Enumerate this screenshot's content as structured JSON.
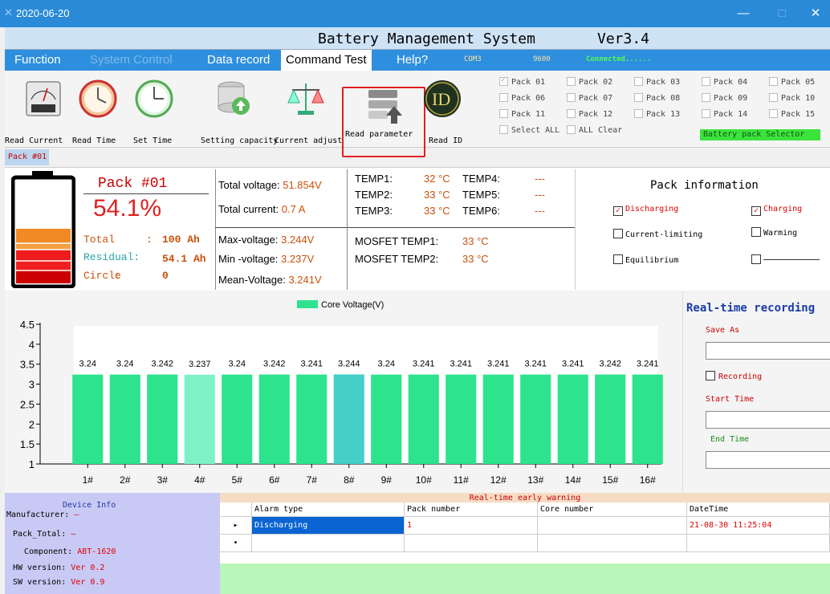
{
  "window": {
    "title": "2020-06-20"
  },
  "header": {
    "title": "Battery Management System",
    "version": "Ver3.4"
  },
  "menu": {
    "items": [
      "Function",
      "System Control",
      "Data record",
      "Command Test",
      "Help?"
    ],
    "com": "COM3",
    "baud": "9600",
    "status": "Connected......"
  },
  "toolbar": {
    "buttons": [
      "Read Current",
      "Read Time",
      "Set Time",
      "Setting capacity",
      "Current adjust",
      "Read parameter",
      "Read ID"
    ]
  },
  "packs": {
    "items": [
      "Pack 01",
      "Pack 02",
      "Pack 03",
      "Pack 04",
      "Pack 05",
      "Pack 06",
      "Pack 07",
      "Pack 08",
      "Pack 09",
      "Pack 10",
      "Pack 11",
      "Pack 12",
      "Pack 13",
      "Pack 14",
      "Pack 15"
    ],
    "select_all": "Select ALL",
    "all_clear": "ALL Clear",
    "selector_label": "Battery pack Selector"
  },
  "tab": {
    "label": "Pack #01"
  },
  "battery": {
    "pack_name": "Pack #01",
    "soc": "54.1%",
    "soc_fraction": 0.541,
    "total_label": "Total",
    "total_value": "100 Ah",
    "residual_label": "Residual:",
    "residual_value": "54.1 Ah",
    "circle_label": "Circle",
    "circle_value": "0",
    "colon": ":"
  },
  "electrical": {
    "total_voltage_label": "Total voltage:",
    "total_voltage": "51.854V",
    "total_current_label": "Total current:",
    "total_current": "0.7 A",
    "max_voltage_label": "Max-voltage:",
    "max_voltage": "3.244V",
    "min_voltage_label": "Min -voltage:",
    "min_voltage": "3.237V",
    "mean_voltage_label": "Mean-Voltage:",
    "mean_voltage": "3.241V"
  },
  "temps": {
    "temp1_label": "TEMP1:",
    "temp1": "32 °C",
    "temp2_label": "TEMP2:",
    "temp2": "33 °C",
    "temp3_label": "TEMP3:",
    "temp3": "33 °C",
    "temp4_label": "TEMP4:",
    "temp4": "---",
    "temp5_label": "TEMP5:",
    "temp5": "---",
    "temp6_label": "TEMP6:",
    "temp6": "---",
    "mosfet1_label": "MOSFET TEMP1:",
    "mosfet1": "33 °C",
    "mosfet2_label": "MOSFET TEMP2:",
    "mosfet2": "33 °C"
  },
  "pack_info": {
    "title": "Pack information",
    "discharging": "Discharging",
    "charging": "Charging",
    "current_limiting": "Current-limiting",
    "warming": "Warming",
    "equilibrium": "Equilibrium",
    "check": "✓"
  },
  "chart_data": {
    "type": "bar",
    "legend": "Core Voltage(V)",
    "categories": [
      "1#",
      "2#",
      "3#",
      "4#",
      "5#",
      "6#",
      "7#",
      "8#",
      "9#",
      "10#",
      "11#",
      "12#",
      "13#",
      "14#",
      "15#",
      "16#"
    ],
    "values": [
      3.24,
      3.24,
      3.242,
      3.237,
      3.24,
      3.242,
      3.241,
      3.244,
      3.24,
      3.241,
      3.241,
      3.241,
      3.241,
      3.241,
      3.242,
      3.241
    ],
    "value_labels": [
      "3.24",
      "3.24",
      "3.242",
      "3.237",
      "3.24",
      "3.242",
      "3.241",
      "3.244",
      "3.24",
      "3.241",
      "3.241",
      "3.241",
      "3.241",
      "3.241",
      "3.242",
      "3.241"
    ],
    "ylim": [
      1,
      4.5
    ],
    "yticks": [
      "1",
      "1.5",
      "2",
      "2.5",
      "3",
      "3.5",
      "4",
      "4.5"
    ],
    "colors": {
      "normal": "#2de38e",
      "min": "#7ef2c6",
      "max": "#44cfc9"
    }
  },
  "recording": {
    "title": "Real-time recording",
    "save_as": "Save As",
    "recording": "Recording",
    "start_time": "Start Time",
    "end_time": "End Time"
  },
  "device_info": {
    "title": "Device Info",
    "manufacturer_label": "Manufacturer:",
    "manufacturer": "—",
    "pack_total_label": "Pack_Total:",
    "pack_total": "—",
    "component_label": "Component:",
    "component": "ABT-1620",
    "hw_label": "HW version:",
    "hw": "Ver 0.2",
    "sw_label": "SW version:",
    "sw": "Ver 0.9"
  },
  "warning": {
    "title": "Real-time early warning",
    "columns": [
      "Alarm type",
      "Pack number",
      "Core number",
      "DateTime"
    ],
    "rows": [
      {
        "alarm": "Discharging",
        "pack": "1",
        "core": "",
        "datetime": "21-08-30 11:25:04"
      }
    ],
    "row_marker": "▸",
    "new_marker": "•"
  }
}
